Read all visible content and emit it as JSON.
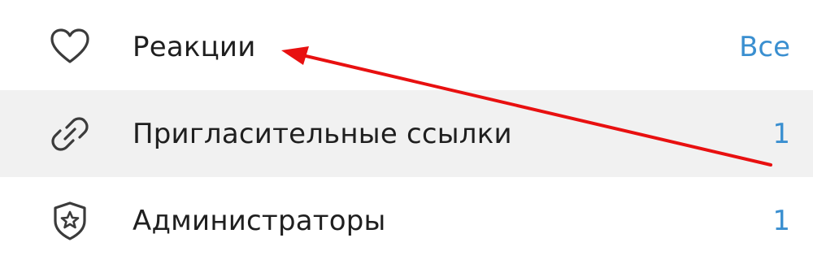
{
  "settings_list": {
    "items": [
      {
        "icon": "heart-icon",
        "label": "Реакции",
        "value": "Все"
      },
      {
        "icon": "link-icon",
        "label": "Пригласительные ссылки",
        "value": "1"
      },
      {
        "icon": "shield-star-icon",
        "label": "Администраторы",
        "value": "1"
      }
    ]
  },
  "colors": {
    "value_text": "#3a8fd0",
    "hover_row": "#f1f1f1",
    "annotation_arrow": "#e81010"
  }
}
